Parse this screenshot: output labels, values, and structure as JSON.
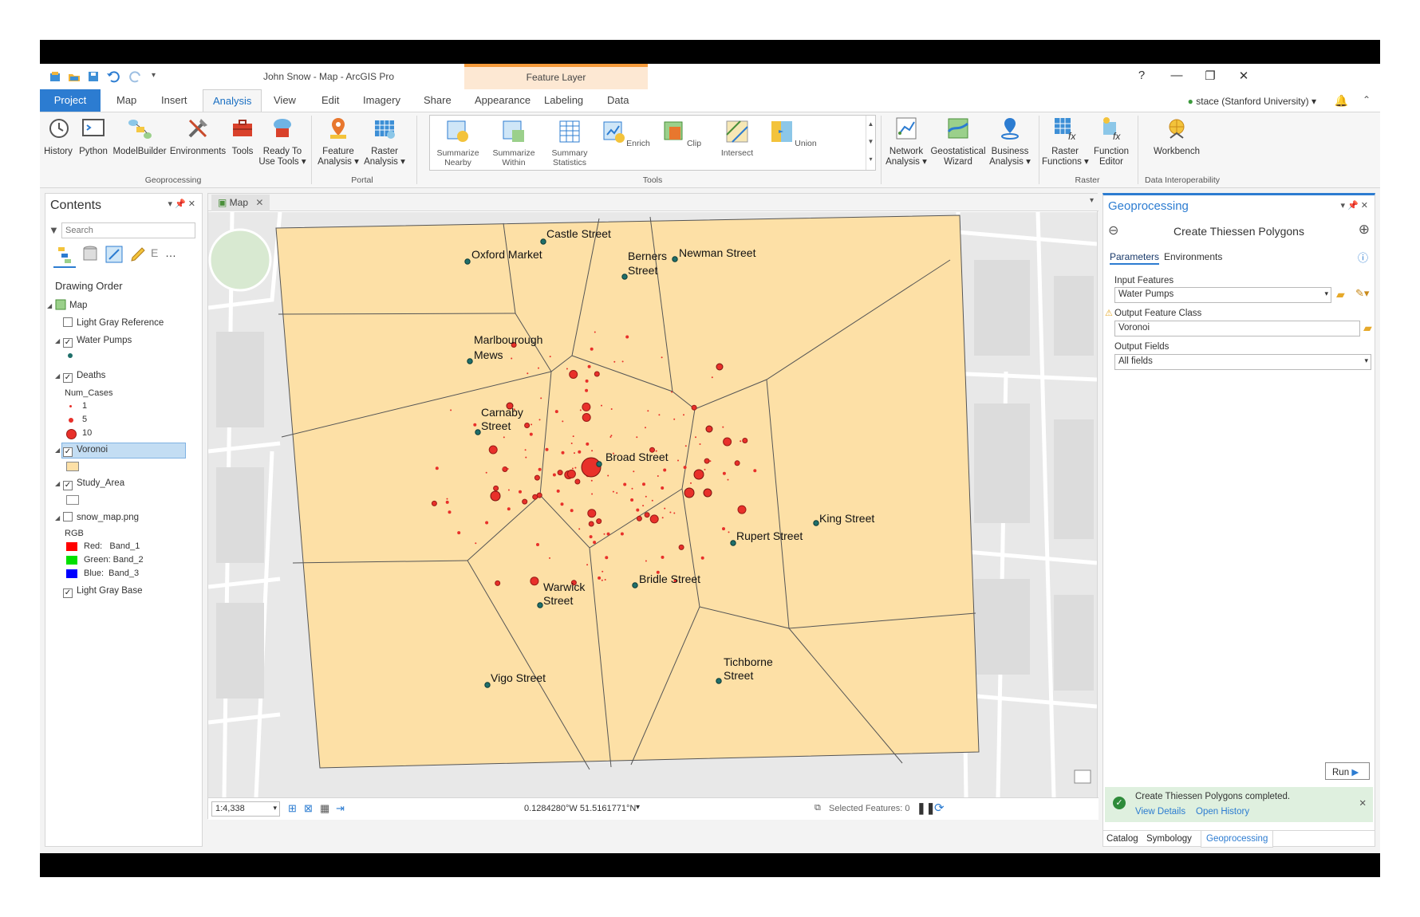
{
  "title": "John Snow - Map - ArcGIS Pro",
  "context_group": "Feature Layer",
  "window_controls": {
    "help": "?",
    "minimize": "—",
    "restore": "❐",
    "close": "✕"
  },
  "tabs": [
    "Project",
    "Map",
    "Insert",
    "Analysis",
    "View",
    "Edit",
    "Imagery",
    "Share",
    "Appearance",
    "Labeling",
    "Data"
  ],
  "active_tab": "Analysis",
  "user": "stace (Stanford University) ▾",
  "ribbon": {
    "geoprocessing": {
      "items": [
        "History",
        "Python",
        "ModelBuilder",
        "Environments",
        "Tools",
        "Ready To\nUse Tools ▾"
      ],
      "label": "Geoprocessing"
    },
    "portal": {
      "items": [
        "Feature\nAnalysis ▾",
        "Raster\nAnalysis ▾"
      ],
      "label": "Portal"
    },
    "tools": {
      "items": [
        "Summarize\nNearby",
        "Summarize\nWithin",
        "Summary\nStatistics",
        "Enrich",
        "Clip",
        "Intersect",
        "Union"
      ],
      "label": "Tools"
    },
    "network": {
      "items": [
        "Network\nAnalysis ▾",
        "Geostatistical\nWizard",
        "Business\nAnalysis ▾"
      ]
    },
    "raster": {
      "items": [
        "Raster\nFunctions ▾",
        "Function\nEditor"
      ],
      "label": "Raster"
    },
    "interop": {
      "items": [
        "Workbench"
      ],
      "label": "Data Interoperability"
    }
  },
  "contents": {
    "title": "Contents",
    "search_placeholder": "Search",
    "drawing_order": "Drawing Order",
    "layers": {
      "map": "Map",
      "light_gray_ref": "Light Gray Reference",
      "water_pumps": "Water Pumps",
      "deaths": "Deaths",
      "num_cases": "Num_Cases",
      "legend_1": "1",
      "legend_5": "5",
      "legend_10": "10",
      "voronoi": "Voronoi",
      "study_area": "Study_Area",
      "snow_map": "snow_map.png",
      "rgb": "RGB",
      "red": "Red:   Band_1",
      "green": "Green: Band_2",
      "blue": "Blue:  Band_3",
      "light_gray_base": "Light Gray Base"
    }
  },
  "map": {
    "tab": "Map",
    "scale": "1:4,338",
    "coordinates": "0.1284280°W 51.5161771°N",
    "selected_features": "Selected Features: 0",
    "labels": {
      "castle": "Castle Street",
      "oxford": "Oxford Market",
      "berners1": "Berners",
      "berners2": "Street",
      "newman": "Newman Street",
      "marl1": "Marlbourough",
      "marl2": "Mews",
      "carnaby1": "Carnaby",
      "carnaby2": "Street",
      "broad": "Broad Street",
      "king": "King Street",
      "rupert": "Rupert Street",
      "warwick1": "Warwick",
      "warwick2": "Street",
      "bridle": "Bridle Street",
      "vigo": "Vigo Street",
      "tich1": "Tichborne",
      "tich2": "Street"
    },
    "colors": {
      "polygon": "#fde0a6",
      "death": "#e8302a",
      "pump": "#1f6f6a",
      "base": "#e6e6e6"
    }
  },
  "geoprocessing": {
    "title": "Geoprocessing",
    "tool": "Create Thiessen Polygons",
    "tab_params": "Parameters",
    "tab_env": "Environments",
    "input_label": "Input Features",
    "input_value": "Water Pumps",
    "output_label": "Output Feature Class",
    "output_value": "Voronoi",
    "fields_label": "Output Fields",
    "fields_value": "All fields",
    "run": "Run",
    "success_msg": "Create Thiessen Polygons completed.",
    "view_details": "View Details",
    "open_history": "Open History",
    "bottom_tabs": [
      "Catalog",
      "Symbology",
      "Geoprocessing"
    ]
  }
}
